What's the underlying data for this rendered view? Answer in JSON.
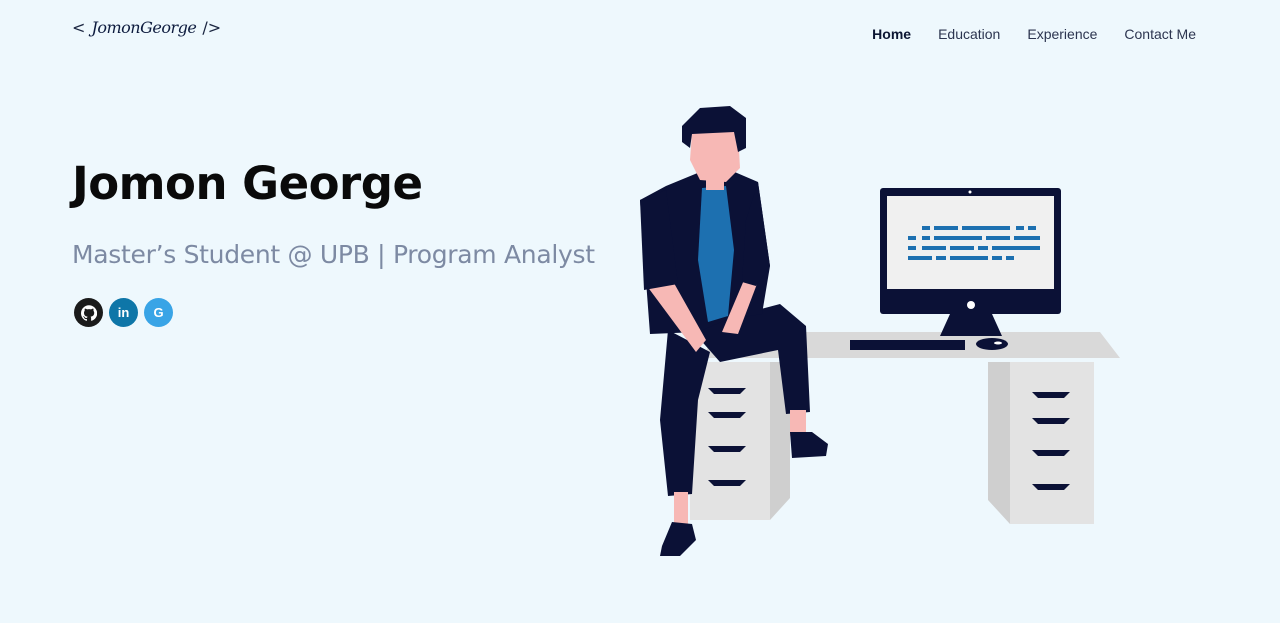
{
  "logo": {
    "open_bracket": "<",
    "signature": "JomonGeorge",
    "close_bracket": "/>"
  },
  "nav": {
    "items": [
      {
        "label": "Home",
        "active": true
      },
      {
        "label": "Education",
        "active": false
      },
      {
        "label": "Experience",
        "active": false
      },
      {
        "label": "Contact Me",
        "active": false
      }
    ]
  },
  "hero": {
    "name": "Jomon George",
    "subtitle": "Master’s Student @ UPB | Program Analyst"
  },
  "socials": {
    "github": {
      "icon": "github-icon",
      "color": "#1b1b1b"
    },
    "linkedin": {
      "icon": "linkedin-icon",
      "glyph": "in",
      "color": "#0e76a8"
    },
    "google": {
      "icon": "google-icon",
      "glyph": "G",
      "color": "#39a4e6"
    }
  },
  "colors": {
    "background": "#eef8fd",
    "navy": "#0b1136",
    "accent_blue": "#1d70b0",
    "subtitle_gray": "#7d8aa3"
  }
}
